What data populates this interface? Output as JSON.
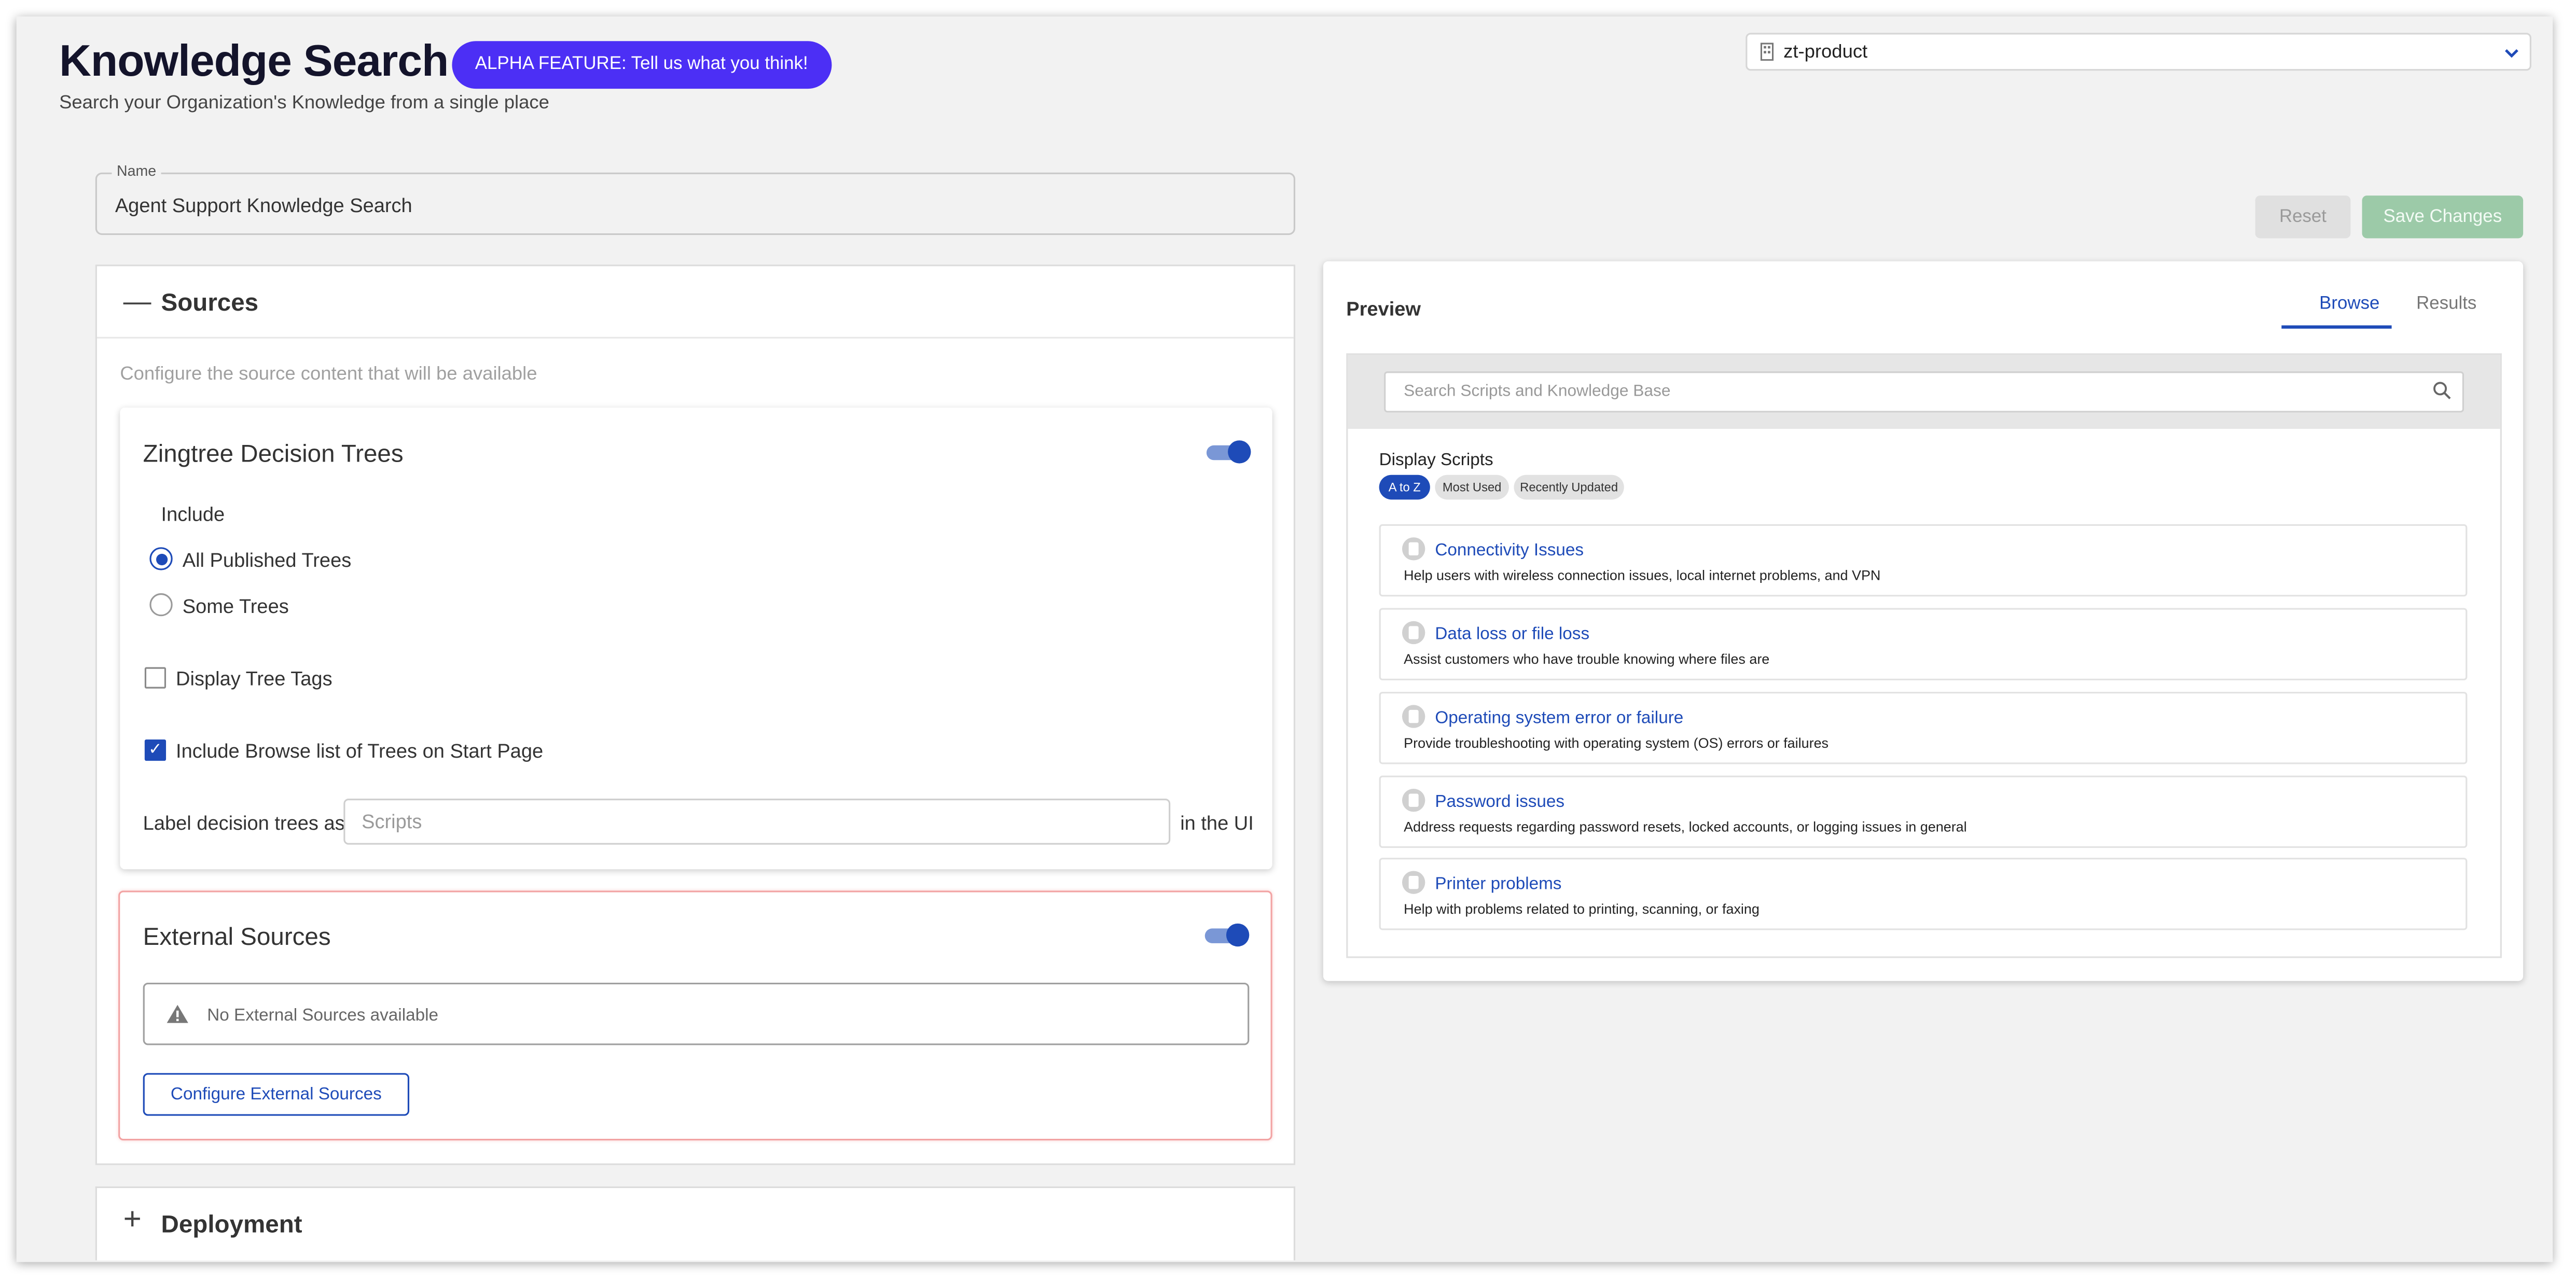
{
  "header": {
    "title": "Knowledge Search",
    "alpha_badge": "ALPHA FEATURE: Tell us what you think!",
    "subtitle": "Search your Organization's Knowledge from a single place"
  },
  "org_select": {
    "value": "zt-product",
    "icon": "building-icon"
  },
  "name_field": {
    "label": "Name",
    "value": "Agent Support Knowledge Search"
  },
  "actions": {
    "reset_label": "Reset",
    "save_label": "Save Changes"
  },
  "sources": {
    "title": "Sources",
    "hint": "Configure the source content that will be available",
    "zingtree": {
      "title": "Zingtree Decision Trees",
      "enabled": true,
      "include_label": "Include",
      "radio_options": [
        "All Published Trees",
        "Some Trees"
      ],
      "selected_option": "All Published Trees",
      "display_tags_label": "Display Tree Tags",
      "display_tags_checked": false,
      "browse_list_label": "Include Browse list of Trees on Start Page",
      "browse_list_checked": true,
      "label_prefix": "Label decision trees as",
      "label_placeholder": "Scripts",
      "label_suffix": "in the UI"
    },
    "external": {
      "title": "External Sources",
      "enabled": true,
      "empty_message": "No External Sources available",
      "configure_label": "Configure External Sources"
    }
  },
  "deployment": {
    "title": "Deployment"
  },
  "preview": {
    "title": "Preview",
    "tabs": [
      "Browse",
      "Results"
    ],
    "active_tab": "Browse",
    "search_placeholder": "Search Scripts and Knowledge Base",
    "display_label": "Display Scripts",
    "sort_chips": [
      "A to Z",
      "Most Used",
      "Recently Updated"
    ],
    "active_chip": "A to Z",
    "scripts": [
      {
        "title": "Connectivity Issues",
        "desc": "Help users with wireless connection issues, local internet problems, and VPN"
      },
      {
        "title": "Data loss or file loss",
        "desc": "Assist customers who have trouble knowing where files are"
      },
      {
        "title": "Operating system error or failure",
        "desc": "Provide troubleshooting with operating system (OS) errors or failures"
      },
      {
        "title": "Password issues",
        "desc": "Address requests regarding password resets, locked accounts, or logging issues in general"
      },
      {
        "title": "Printer problems",
        "desc": "Help with problems related to printing, scanning, or faxing"
      }
    ]
  },
  "colors": {
    "accent": "#1e4bb8",
    "alpha_badge": "#4c2ff5",
    "save_disabled": "#9ccaa8",
    "error_border": "#f2a3a3"
  }
}
